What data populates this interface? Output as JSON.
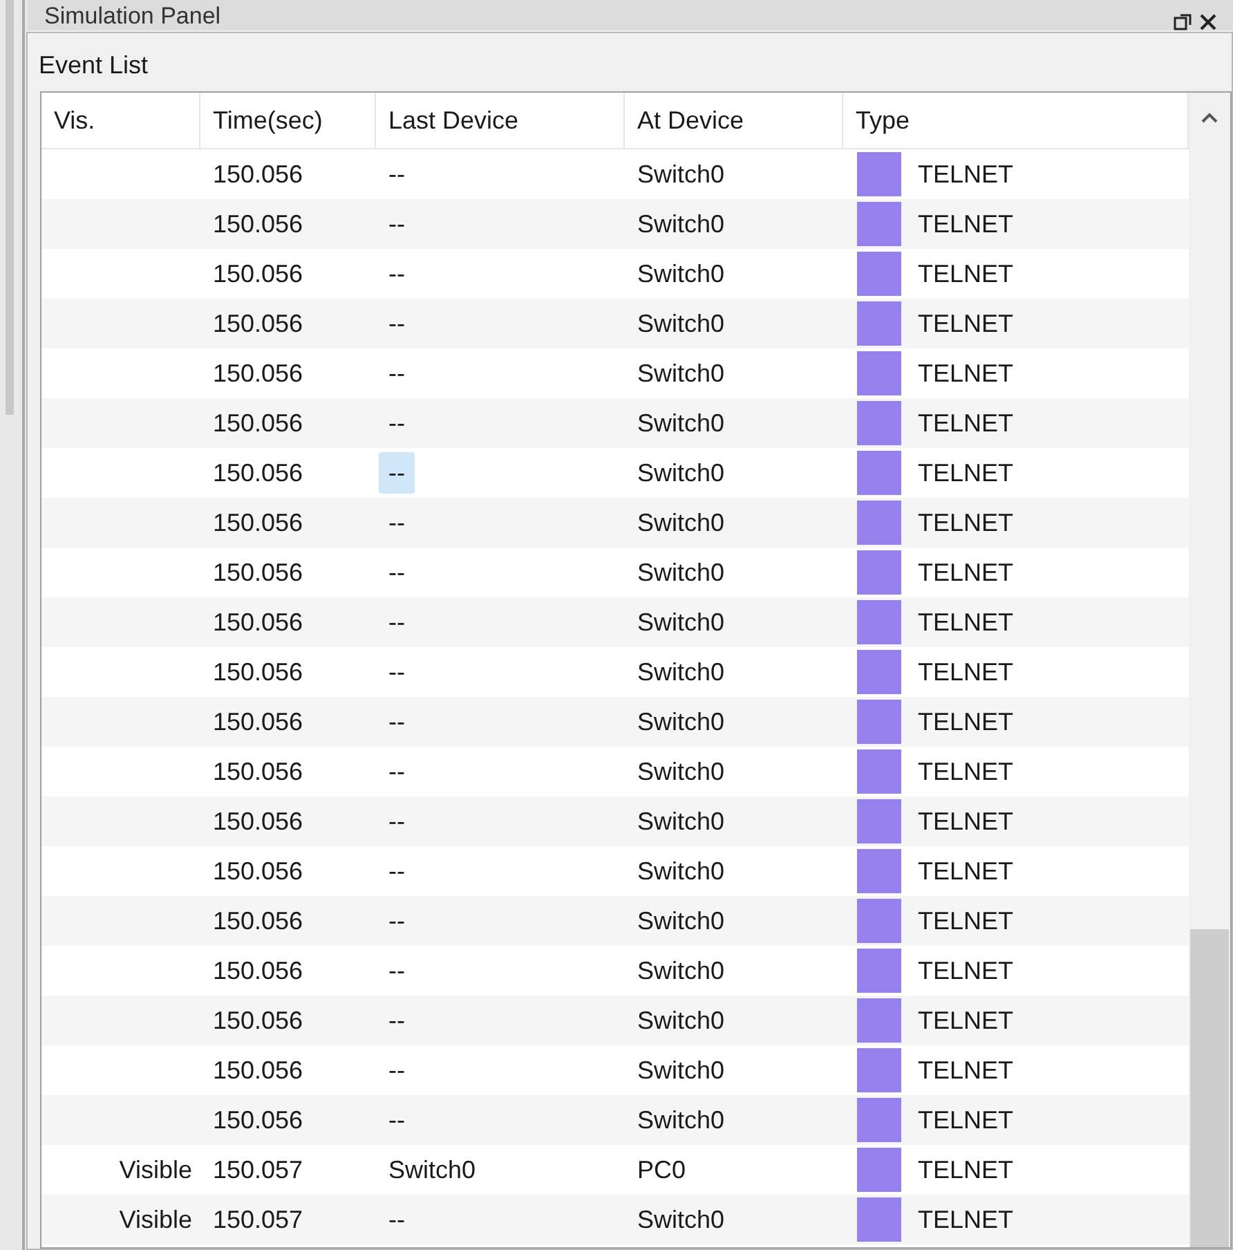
{
  "panel": {
    "title": "Simulation Panel"
  },
  "event_list": {
    "title": "Event List",
    "columns": [
      "Vis.",
      "Time(sec)",
      "Last Device",
      "At Device",
      "Type"
    ],
    "rows": [
      {
        "vis": "",
        "time": "150.056",
        "last_device": "--",
        "at_device": "Switch0",
        "type": "TELNET",
        "color": "#9580ee",
        "focused": false
      },
      {
        "vis": "",
        "time": "150.056",
        "last_device": "--",
        "at_device": "Switch0",
        "type": "TELNET",
        "color": "#9580ee",
        "focused": false
      },
      {
        "vis": "",
        "time": "150.056",
        "last_device": "--",
        "at_device": "Switch0",
        "type": "TELNET",
        "color": "#9580ee",
        "focused": false
      },
      {
        "vis": "",
        "time": "150.056",
        "last_device": "--",
        "at_device": "Switch0",
        "type": "TELNET",
        "color": "#9580ee",
        "focused": false
      },
      {
        "vis": "",
        "time": "150.056",
        "last_device": "--",
        "at_device": "Switch0",
        "type": "TELNET",
        "color": "#9580ee",
        "focused": false
      },
      {
        "vis": "",
        "time": "150.056",
        "last_device": "--",
        "at_device": "Switch0",
        "type": "TELNET",
        "color": "#9580ee",
        "focused": false
      },
      {
        "vis": "",
        "time": "150.056",
        "last_device": "--",
        "at_device": "Switch0",
        "type": "TELNET",
        "color": "#9580ee",
        "focused": true
      },
      {
        "vis": "",
        "time": "150.056",
        "last_device": "--",
        "at_device": "Switch0",
        "type": "TELNET",
        "color": "#9580ee",
        "focused": false
      },
      {
        "vis": "",
        "time": "150.056",
        "last_device": "--",
        "at_device": "Switch0",
        "type": "TELNET",
        "color": "#9580ee",
        "focused": false
      },
      {
        "vis": "",
        "time": "150.056",
        "last_device": "--",
        "at_device": "Switch0",
        "type": "TELNET",
        "color": "#9580ee",
        "focused": false
      },
      {
        "vis": "",
        "time": "150.056",
        "last_device": "--",
        "at_device": "Switch0",
        "type": "TELNET",
        "color": "#9580ee",
        "focused": false
      },
      {
        "vis": "",
        "time": "150.056",
        "last_device": "--",
        "at_device": "Switch0",
        "type": "TELNET",
        "color": "#9580ee",
        "focused": false
      },
      {
        "vis": "",
        "time": "150.056",
        "last_device": "--",
        "at_device": "Switch0",
        "type": "TELNET",
        "color": "#9580ee",
        "focused": false
      },
      {
        "vis": "",
        "time": "150.056",
        "last_device": "--",
        "at_device": "Switch0",
        "type": "TELNET",
        "color": "#9580ee",
        "focused": false
      },
      {
        "vis": "",
        "time": "150.056",
        "last_device": "--",
        "at_device": "Switch0",
        "type": "TELNET",
        "color": "#9580ee",
        "focused": false
      },
      {
        "vis": "",
        "time": "150.056",
        "last_device": "--",
        "at_device": "Switch0",
        "type": "TELNET",
        "color": "#9580ee",
        "focused": false
      },
      {
        "vis": "",
        "time": "150.056",
        "last_device": "--",
        "at_device": "Switch0",
        "type": "TELNET",
        "color": "#9580ee",
        "focused": false
      },
      {
        "vis": "",
        "time": "150.056",
        "last_device": "--",
        "at_device": "Switch0",
        "type": "TELNET",
        "color": "#9580ee",
        "focused": false
      },
      {
        "vis": "",
        "time": "150.056",
        "last_device": "--",
        "at_device": "Switch0",
        "type": "TELNET",
        "color": "#9580ee",
        "focused": false
      },
      {
        "vis": "",
        "time": "150.056",
        "last_device": "--",
        "at_device": "Switch0",
        "type": "TELNET",
        "color": "#9580ee",
        "focused": false
      },
      {
        "vis": "Visible",
        "time": "150.057",
        "last_device": "Switch0",
        "at_device": "PC0",
        "type": "TELNET",
        "color": "#9580ee",
        "focused": false
      },
      {
        "vis": "Visible",
        "time": "150.057",
        "last_device": "--",
        "at_device": "Switch0",
        "type": "TELNET",
        "color": "#9580ee",
        "focused": false
      }
    ]
  }
}
